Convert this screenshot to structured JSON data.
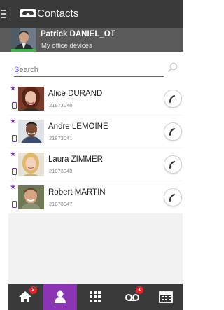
{
  "app": {
    "title": "Contacts",
    "menu_icon": "hamburger-menu-icon",
    "logo_icon": "voicemail-tape-icon"
  },
  "user": {
    "name": "Patrick DANIEL_OT",
    "subtitle": "My office devices",
    "presence_color": "#3fb24a"
  },
  "search": {
    "placeholder": "Search",
    "value": "",
    "icon": "search-icon"
  },
  "contacts": [
    {
      "name": "Alice DURAND",
      "number": "21873040",
      "favorite": true,
      "device": "mobile-device-icon",
      "action_icon": "phone-call-icon"
    },
    {
      "name": "Andre LEMOINE",
      "number": "21873041",
      "favorite": true,
      "device": "mobile-device-icon",
      "action_icon": "phone-call-icon"
    },
    {
      "name": "Laura ZIMMER",
      "number": "21873048",
      "favorite": true,
      "device": "mobile-device-icon",
      "action_icon": "phone-call-icon"
    },
    {
      "name": "Robert MARTIN",
      "number": "21873047",
      "favorite": true,
      "device": "mobile-device-icon",
      "action_icon": "phone-call-icon"
    }
  ],
  "bottom_nav": {
    "items": [
      {
        "icon": "home-icon",
        "badge": "2",
        "active": false
      },
      {
        "icon": "contacts-person-icon",
        "badge": "",
        "active": true
      },
      {
        "icon": "dialpad-grid-icon",
        "badge": "",
        "active": false
      },
      {
        "icon": "voicemail-icon",
        "badge": "1",
        "active": false
      },
      {
        "icon": "calendar-icon",
        "badge": "",
        "active": false
      }
    ]
  },
  "colors": {
    "accent": "#8b35b5",
    "top_bar": "#3a3a3a",
    "user_bar": "#5a5a5a",
    "badge": "#e4232b",
    "favorite": "#7b2fbe"
  }
}
